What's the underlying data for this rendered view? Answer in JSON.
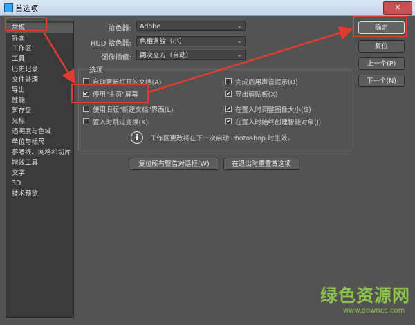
{
  "window": {
    "title": "首选项",
    "close_glyph": "✕"
  },
  "sidebar": {
    "items": [
      {
        "label": "常规",
        "active": true
      },
      {
        "label": "界面"
      },
      {
        "label": "工作区"
      },
      {
        "label": "工具"
      },
      {
        "label": "历史记录"
      },
      {
        "label": "文件处理"
      },
      {
        "label": "导出"
      },
      {
        "label": "性能"
      },
      {
        "label": "暂存盘"
      },
      {
        "label": "光标"
      },
      {
        "label": "透明度与色域"
      },
      {
        "label": "单位与标尺"
      },
      {
        "label": "参考线、网格和切片"
      },
      {
        "label": "增效工具"
      },
      {
        "label": "文字"
      },
      {
        "label": "3D"
      },
      {
        "label": "技术预览"
      }
    ]
  },
  "fields": {
    "color_picker": {
      "label": "拾色器:",
      "value": "Adobe"
    },
    "hud_picker": {
      "label": "HUD 拾色器:",
      "value": "色相条纹（小）"
    },
    "interpolation": {
      "label": "图像插值:",
      "value": "两次立方（自动）"
    }
  },
  "options": {
    "group_label": "选项",
    "left": [
      {
        "label": "自动更新打开的文档(A)",
        "checked": false
      },
      {
        "label": "停用\"主页\"屏幕",
        "checked": true
      },
      {
        "label": "使用旧版\"新建文档\"界面(L)",
        "checked": false
      },
      {
        "label": "置入时跳过变换(K)",
        "checked": false
      }
    ],
    "right": [
      {
        "label": "完成后用声音提示(D)",
        "checked": false
      },
      {
        "label": "导出剪贴板(X)",
        "checked": true
      },
      {
        "label": "在置入时调整图像大小(G)",
        "checked": true
      },
      {
        "label": "在置入时始终创建智能对象(J)",
        "checked": true
      }
    ],
    "info": "工作区更改将在下一次启动 Photoshop 时生效。"
  },
  "buttons": {
    "ok": "确定",
    "reset": "复位",
    "prev": "上一个(P)",
    "next": "下一个(N)",
    "reset_warnings": "复位所有警告对话框(W)",
    "reset_on_quit": "在退出时重置首选项"
  },
  "icons": {
    "info": "info-icon",
    "check": "✔",
    "chevron": "⌄"
  },
  "watermark": {
    "main": "绿色资源网",
    "sub": "www.downcc.com"
  },
  "colors": {
    "highlight": "#e23b32",
    "panel": "#535353",
    "sidebar": "#3a3a3a"
  }
}
